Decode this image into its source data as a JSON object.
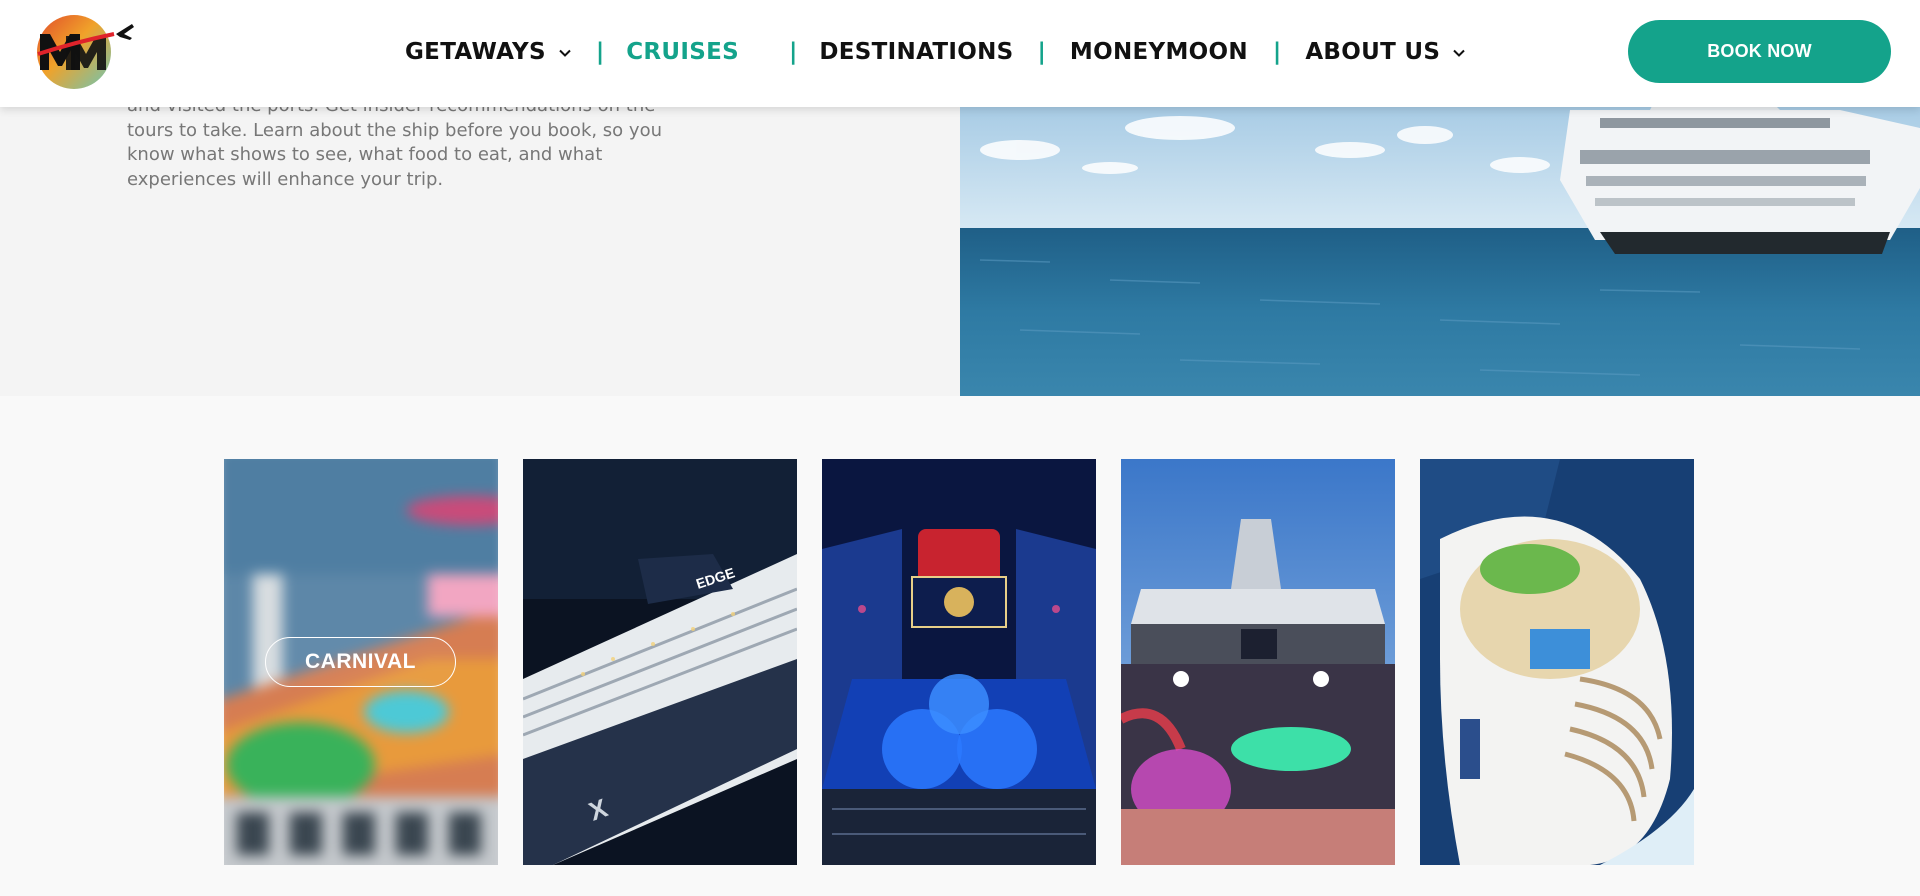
{
  "header": {
    "logo_icon": "mm-travel-logo",
    "nav": [
      {
        "label": "GETAWAYS",
        "has_dropdown": true,
        "active": false
      },
      {
        "label": "CRUISES",
        "has_dropdown": false,
        "active": true
      },
      {
        "label": "DESTINATIONS",
        "has_dropdown": false,
        "active": false
      },
      {
        "label": "MONEYMOON",
        "has_dropdown": false,
        "active": false
      },
      {
        "label": "ABOUT US",
        "has_dropdown": true,
        "active": false
      }
    ],
    "separator": "|",
    "book_label": "BOOK NOW"
  },
  "hero": {
    "text": "and visited the ports. Get insider recommendations on the tours to take. Learn about the ship before you book, so you know what shows to see, what food to eat, and what experiences will enhance your trip.",
    "image": "cruise-ship-at-sea"
  },
  "cruise_lines": [
    {
      "label": "CARNIVAL",
      "image": "carnival-ship-deck",
      "hovered": true
    },
    {
      "label": "",
      "image": "celebrity-edge-ship",
      "hovered": false
    },
    {
      "label": "",
      "image": "disney-ship-pool-deck",
      "hovered": false
    },
    {
      "label": "",
      "image": "royal-caribbean-deck",
      "hovered": false
    },
    {
      "label": "",
      "image": "royal-caribbean-ship-stern",
      "hovered": false
    }
  ],
  "colors": {
    "accent": "#14a38b",
    "nav_text": "#111111",
    "body_text": "#777777",
    "page_bg": "#f9f9f9"
  }
}
